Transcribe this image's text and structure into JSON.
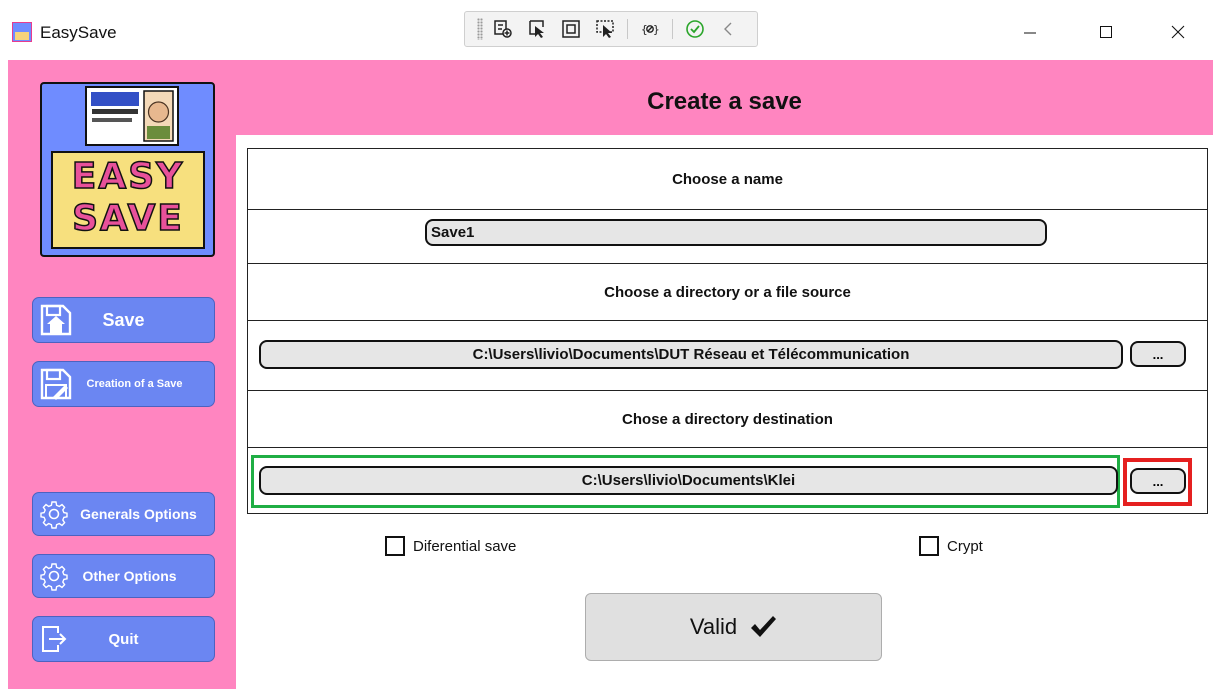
{
  "window": {
    "title": "EasySave",
    "controls": [
      "minimize-icon",
      "maximize-icon",
      "close-icon"
    ]
  },
  "devtools_toolbar": {
    "icons": [
      "live-visual-tree-icon",
      "select-element-icon",
      "display-layout-adorners-icon",
      "track-focus-icon",
      "binding-failures-icon",
      "hot-reload-ok-icon",
      "collapse-chevron-icon"
    ]
  },
  "sidebar": {
    "logo_text_line1": "EASY",
    "logo_text_line2": "SAVE",
    "items": [
      {
        "label": "Save",
        "icon": "floppy-upload-icon"
      },
      {
        "label": "Creation of a Save",
        "icon": "floppy-edit-icon"
      },
      {
        "label": "Generals Options",
        "icon": "gear-icon"
      },
      {
        "label": "Other Options",
        "icon": "gear-icon"
      },
      {
        "label": "Quit",
        "icon": "exit-icon"
      }
    ]
  },
  "main": {
    "title": "Create a save",
    "name_section": {
      "label": "Choose a name",
      "value": "Save1"
    },
    "source_section": {
      "label": "Choose a directory or a file source",
      "value": "C:\\Users\\livio\\Documents\\DUT Réseau et Télécommunication",
      "browse_label": "..."
    },
    "destination_section": {
      "label": "Chose a directory destination",
      "value": "C:\\Users\\livio\\Documents\\Klei",
      "browse_label": "..."
    },
    "options": {
      "differential_label": "Diferential save",
      "crypt_label": "Crypt"
    },
    "valid_button": {
      "label": "Valid"
    }
  },
  "colors": {
    "sidebar_bg": "#ff85c0",
    "nav_button": "#6b86f2",
    "highlight_green": "#1fae44",
    "highlight_red": "#e52020"
  }
}
